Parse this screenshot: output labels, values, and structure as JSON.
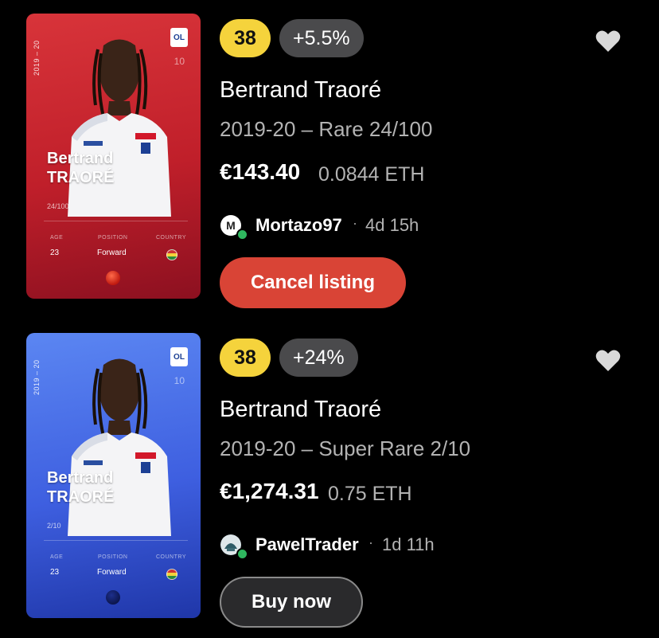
{
  "listings": [
    {
      "card": {
        "season_vertical": "2019 – 20",
        "club": "OL",
        "shirt_number": "10",
        "first_name": "Bertrand",
        "last_name": "TRAORÉ",
        "serial": "24/100",
        "age_label": "AGE",
        "age": "23",
        "position_label": "POSITION",
        "position": "Forward",
        "country_label": "COUNTRY",
        "rarity_color": "#c01f2a"
      },
      "score": "38",
      "delta": "+5.5%",
      "title": "Bertrand Traoré",
      "subtitle": "2019-20 – Rare 24/100",
      "price": "€143.40",
      "eth": "0.0844 ETH",
      "seller_initial": "M",
      "seller": "Mortazo97",
      "separator": "·",
      "time": "4d 15h",
      "action": "Cancel listing",
      "action_color": "#d94436"
    },
    {
      "card": {
        "season_vertical": "2019 – 20",
        "club": "OL",
        "shirt_number": "10",
        "first_name": "Bertrand",
        "last_name": "TRAORÉ",
        "serial": "2/10",
        "age_label": "AGE",
        "age": "23",
        "position_label": "POSITION",
        "position": "Forward",
        "country_label": "COUNTRY",
        "rarity_color": "#3e5fe0"
      },
      "score": "38",
      "delta": "+24%",
      "title": "Bertrand Traoré",
      "subtitle": "2019-20 – Super Rare 2/10",
      "price": "€1,274.31",
      "eth": "0.75 ETH",
      "seller_initial": "",
      "seller": "PawelTrader",
      "separator": "·",
      "time": "1d 11h",
      "action": "Buy now",
      "action_color": "#2a2a2c"
    }
  ],
  "colors": {
    "score_badge": "#f5d33c",
    "online": "#2fb75f",
    "heart": "#d9d9d9"
  }
}
